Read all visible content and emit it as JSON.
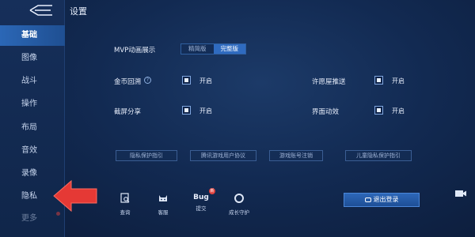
{
  "header": {
    "title": "设置"
  },
  "sidebar": {
    "items": [
      {
        "label": "基础",
        "active": true
      },
      {
        "label": "图像"
      },
      {
        "label": "战斗"
      },
      {
        "label": "操作"
      },
      {
        "label": "布局"
      },
      {
        "label": "音效"
      },
      {
        "label": "录像"
      },
      {
        "label": "隐私"
      },
      {
        "label": "更多",
        "badge": true
      }
    ]
  },
  "settings": {
    "mvp": {
      "label": "MVP动画展示",
      "options": [
        "精简版",
        "完整版"
      ],
      "selected": "完整版"
    },
    "coin_replay": {
      "label": "金币回溯",
      "value": "开启"
    },
    "wish_push": {
      "label": "许愿屋推送",
      "value": "开启"
    },
    "screenshot_share": {
      "label": "截屏分享",
      "value": "开启"
    },
    "ui_animation": {
      "label": "界面动效",
      "value": "开启"
    }
  },
  "links": [
    "隐私保护指引",
    "腾讯游戏用户协议",
    "游戏账号注销",
    "儿童隐私保护指引"
  ],
  "bottom_bar": {
    "items": [
      {
        "label": "查询",
        "icon": "search-doc-icon"
      },
      {
        "label": "客服",
        "icon": "cat-face-icon"
      },
      {
        "label": "提交",
        "icon": "bug-icon",
        "icon_text": "Bug",
        "badge": "新"
      },
      {
        "label": "成长守护",
        "icon": "ring-icon"
      }
    ],
    "logout_label": "退出登录"
  },
  "colors": {
    "accent": "#2f6bc0",
    "arrow": "#e53935",
    "badge": "#e0413d"
  }
}
